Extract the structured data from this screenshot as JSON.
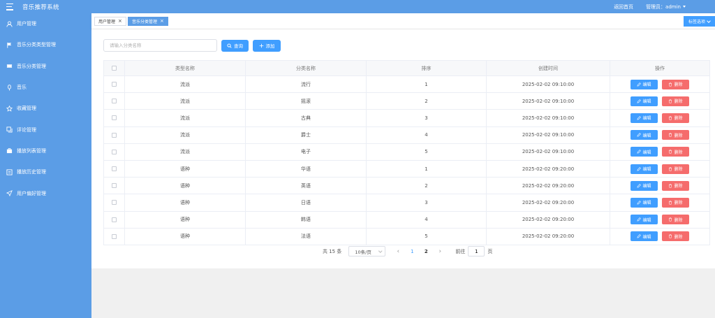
{
  "app": {
    "title": "音乐推荐系统",
    "home_link": "返回首页",
    "user_label": "管理员：admin"
  },
  "sidebar": {
    "items": [
      {
        "label": "用户管理",
        "icon": "user-icon"
      },
      {
        "label": "音乐分类类型管理",
        "icon": "flag-icon"
      },
      {
        "label": "音乐分类管理",
        "icon": "ticket-icon"
      },
      {
        "label": "音乐",
        "icon": "mic-icon"
      },
      {
        "label": "收藏管理",
        "icon": "star-icon"
      },
      {
        "label": "评论管理",
        "icon": "copy-icon"
      },
      {
        "label": "播放列表管理",
        "icon": "suitcase-icon"
      },
      {
        "label": "播放历史管理",
        "icon": "history-icon"
      },
      {
        "label": "用户偏好管理",
        "icon": "send-icon"
      }
    ]
  },
  "tabs": [
    {
      "label": "用户管理",
      "active": false
    },
    {
      "label": "音乐分类管理",
      "active": true
    }
  ],
  "tab_options": "标签选项",
  "search": {
    "placeholder": "请输入分类名称",
    "value": "",
    "query_label": "查询",
    "add_label": "添加"
  },
  "table": {
    "headers": [
      "",
      "类型名称",
      "分类名称",
      "排序",
      "创建时间",
      "操作"
    ],
    "edit_label": "编辑",
    "delete_label": "删除",
    "rows": [
      {
        "type": "流派",
        "name": "流行",
        "sort": "1",
        "created": "2025-02-02 09:10:00"
      },
      {
        "type": "流派",
        "name": "摇滚",
        "sort": "2",
        "created": "2025-02-02 09:10:00"
      },
      {
        "type": "流派",
        "name": "古典",
        "sort": "3",
        "created": "2025-02-02 09:10:00"
      },
      {
        "type": "流派",
        "name": "爵士",
        "sort": "4",
        "created": "2025-02-02 09:10:00"
      },
      {
        "type": "流派",
        "name": "电子",
        "sort": "5",
        "created": "2025-02-02 09:10:00"
      },
      {
        "type": "语种",
        "name": "华语",
        "sort": "1",
        "created": "2025-02-02 09:20:00"
      },
      {
        "type": "语种",
        "name": "英语",
        "sort": "2",
        "created": "2025-02-02 09:20:00"
      },
      {
        "type": "语种",
        "name": "日语",
        "sort": "3",
        "created": "2025-02-02 09:20:00"
      },
      {
        "type": "语种",
        "name": "韩语",
        "sort": "4",
        "created": "2025-02-02 09:20:00"
      },
      {
        "type": "语种",
        "name": "法语",
        "sort": "5",
        "created": "2025-02-02 09:20:00"
      }
    ]
  },
  "pagination": {
    "total": "共 15 条",
    "page_size": "10条/页",
    "pages": [
      "1",
      "2"
    ],
    "current": "1",
    "goto_label": "前往",
    "goto_value": "1",
    "page_suffix": "页"
  },
  "colors": {
    "primary": "#409eff",
    "sidebar": "#5b9de6",
    "danger": "#f56c6c"
  }
}
